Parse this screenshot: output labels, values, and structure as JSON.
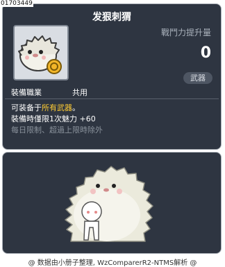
{
  "item": {
    "id": "01703449",
    "name": "发狠刺猬",
    "power_label": "戰鬥力提升量",
    "power_value": "0",
    "category": "武器",
    "job_label": "裝備職業",
    "job_value": "共用",
    "desc_prefix": "可装备于",
    "desc_highlight": "所有武器",
    "desc_suffix": "。",
    "equip_limit_label": "裝備時僅限1次魅力",
    "equip_limit_value": "+60",
    "limit_note": "每日限制、超過上限時除外"
  },
  "footer": {
    "text": "@ 数据由小册子整理, WzComparerR2-NTMS解析 @"
  },
  "colors": {
    "panel_bg": "#2e3541",
    "highlight": "#ffcc33",
    "muted": "#8a929c"
  }
}
